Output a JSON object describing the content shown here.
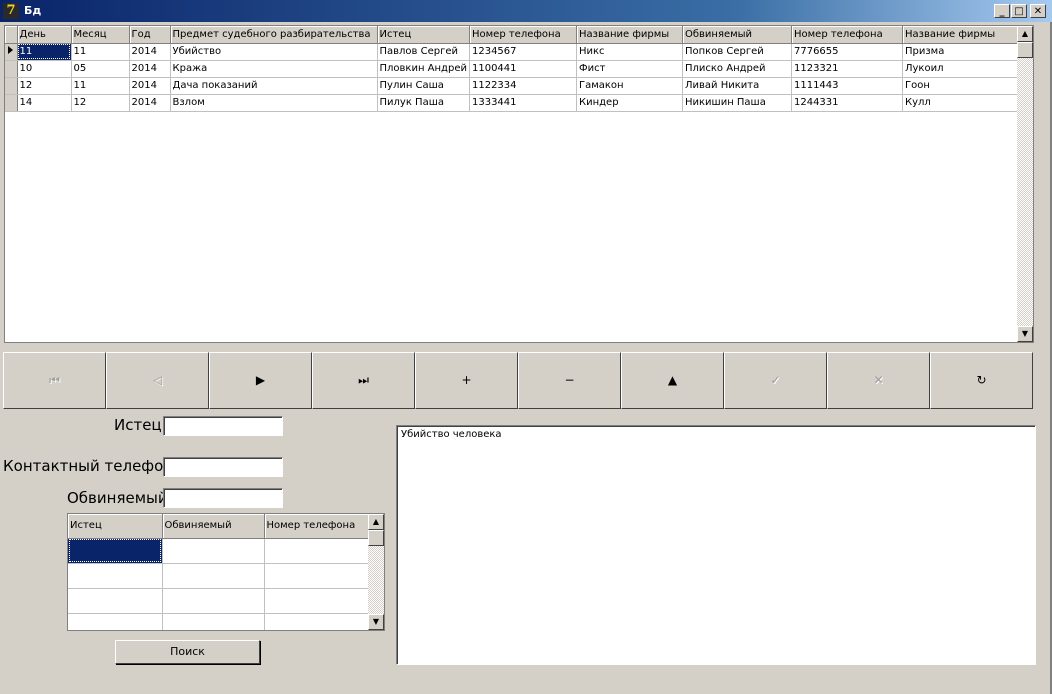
{
  "window": {
    "title": "Бд",
    "icon_glyph": "7",
    "minimize_glyph": "_",
    "maximize_glyph": "□",
    "close_glyph": "✕"
  },
  "main_grid": {
    "columns": [
      "День",
      "Месяц",
      "Год",
      "Предмет судебного разбирательства",
      "Истец",
      "Номер телефона",
      "Название фирмы",
      "Обвиняемый",
      "Номер телефона",
      "Название фирмы"
    ],
    "rows": [
      [
        "11",
        "11",
        "2014",
        "Убийство",
        "Павлов Сергей",
        "1234567",
        "Никс",
        "Попков Сергей",
        "7776655",
        "Призма"
      ],
      [
        "10",
        "05",
        "2014",
        "Кража",
        "Пловкин Андрей",
        "1100441",
        "Фист",
        "Плиско Андрей",
        "1123321",
        "Лукоил"
      ],
      [
        "12",
        "11",
        "2014",
        "Дача показаний",
        "Пулин Саша",
        "1122334",
        "Гамакон",
        "Ливай Никита",
        "1111443",
        "Гоон"
      ],
      [
        "14",
        "12",
        "2014",
        "Взлом",
        "Пилук Паша",
        "1333441",
        "Киндер",
        "Никишин Паша",
        "1244331",
        "Кулл"
      ]
    ],
    "scroll_up_glyph": "▲",
    "scroll_down_glyph": "▼"
  },
  "navigator": {
    "buttons": [
      {
        "name": "first",
        "icon": "first-record-icon",
        "glyph": "⏮",
        "enabled": false
      },
      {
        "name": "prior",
        "icon": "prior-record-icon",
        "glyph": "◁",
        "enabled": false
      },
      {
        "name": "next",
        "icon": "next-record-icon",
        "glyph": "▶",
        "enabled": true
      },
      {
        "name": "last",
        "icon": "last-record-icon",
        "glyph": "⏭",
        "enabled": true
      },
      {
        "name": "insert",
        "icon": "plus-icon",
        "glyph": "+",
        "enabled": true
      },
      {
        "name": "delete",
        "icon": "minus-icon",
        "glyph": "−",
        "enabled": true
      },
      {
        "name": "edit",
        "icon": "triangle-up-icon",
        "glyph": "▲",
        "enabled": true
      },
      {
        "name": "post",
        "icon": "check-icon",
        "glyph": "✓",
        "enabled": false
      },
      {
        "name": "cancel",
        "icon": "cross-icon",
        "glyph": "✕",
        "enabled": false
      },
      {
        "name": "refresh",
        "icon": "refresh-icon",
        "glyph": "↻",
        "enabled": true
      }
    ]
  },
  "form": {
    "plaintiff_label": "Истец",
    "plaintiff_value": "",
    "phone_label": "Контактный телефон",
    "phone_value": "",
    "defendant_label": "Обвиняемый",
    "defendant_value": ""
  },
  "search_grid": {
    "columns": [
      "Истец",
      "Обвиняемый",
      "Номер телефона"
    ],
    "rows": [
      [
        "",
        "",
        ""
      ],
      [
        "",
        "",
        ""
      ],
      [
        "",
        "",
        ""
      ],
      [
        "",
        "",
        ""
      ]
    ],
    "scroll_up_glyph": "▲",
    "scroll_down_glyph": "▼"
  },
  "search_button": "Поиск",
  "memo": {
    "text": "Убийство человека"
  },
  "colors": {
    "face": "#d4d0c8",
    "selection": "#0a246a",
    "title_start": "#0a246a"
  }
}
